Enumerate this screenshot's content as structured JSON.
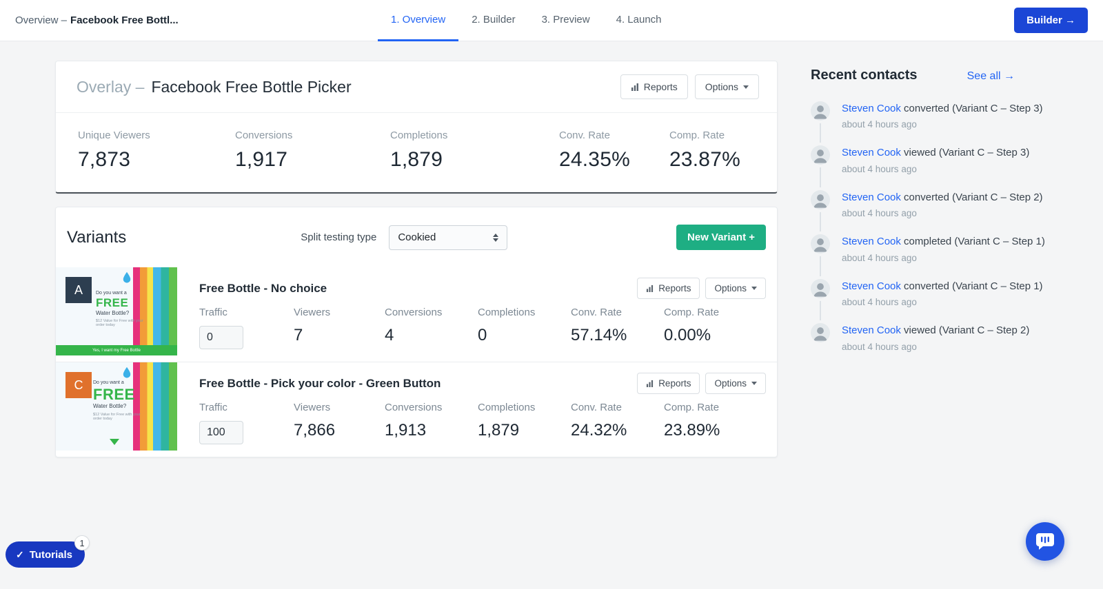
{
  "navbar": {
    "breadcrumb_prefix": "Overview –",
    "breadcrumb_title": "Facebook Free Bottl...",
    "tabs": [
      {
        "label": "1. Overview"
      },
      {
        "label": "2. Builder"
      },
      {
        "label": "3. Preview"
      },
      {
        "label": "4. Launch"
      }
    ],
    "builder_button": "Builder →"
  },
  "buttons": {
    "reports": "Reports",
    "options": "Options"
  },
  "overview": {
    "type_label": "Overlay –",
    "title": "Facebook Free Bottle Picker",
    "stats": [
      {
        "label": "Unique Viewers",
        "value": "7,873"
      },
      {
        "label": "Conversions",
        "value": "1,917"
      },
      {
        "label": "Completions",
        "value": "1,879"
      },
      {
        "label": "Conv. Rate",
        "value": "24.35%"
      },
      {
        "label": "Comp. Rate",
        "value": "23.87%"
      }
    ]
  },
  "variants": {
    "title": "Variants",
    "split_label": "Split testing type",
    "split_value": "Cookied",
    "new_variant": "New Variant +",
    "items": [
      {
        "letter": "A",
        "name": "Free Bottle - No choice",
        "traffic_label": "Traffic",
        "traffic_value": "0",
        "cols": [
          {
            "label": "Viewers",
            "value": "7"
          },
          {
            "label": "Conversions",
            "value": "4"
          },
          {
            "label": "Completions",
            "value": "0"
          },
          {
            "label": "Conv. Rate",
            "value": "57.14%"
          },
          {
            "label": "Comp. Rate",
            "value": "0.00%"
          }
        ]
      },
      {
        "letter": "C",
        "name": "Free Bottle - Pick your color - Green Button",
        "traffic_label": "Traffic",
        "traffic_value": "100",
        "cols": [
          {
            "label": "Viewers",
            "value": "7,866"
          },
          {
            "label": "Conversions",
            "value": "1,913"
          },
          {
            "label": "Completions",
            "value": "1,879"
          },
          {
            "label": "Conv. Rate",
            "value": "24.32%"
          },
          {
            "label": "Comp. Rate",
            "value": "23.89%"
          }
        ]
      }
    ]
  },
  "thumb": {
    "line1": "Do you want a",
    "free": "FREE",
    "line3": "Water Bottle?",
    "line4": "$12 Value for Free with your order today",
    "bar_text": "Yes, I want my Free Bottle"
  },
  "contacts": {
    "title": "Recent contacts",
    "see_all": "See all →",
    "items": [
      {
        "name": "Steven Cook",
        "action": " converted (Variant C – Step 3)",
        "time": "about 4 hours ago"
      },
      {
        "name": "Steven Cook",
        "action": " viewed (Variant C – Step 3)",
        "time": "about 4 hours ago"
      },
      {
        "name": "Steven Cook",
        "action": " converted (Variant C – Step 2)",
        "time": "about 4 hours ago"
      },
      {
        "name": "Steven Cook",
        "action": " completed (Variant C – Step 1)",
        "time": "about 4 hours ago"
      },
      {
        "name": "Steven Cook",
        "action": " converted (Variant C – Step 1)",
        "time": "about 4 hours ago"
      },
      {
        "name": "Steven Cook",
        "action": " viewed (Variant C – Step 2)",
        "time": "about 4 hours ago"
      }
    ]
  },
  "footer": {
    "tutorials": "Tutorials",
    "tutorials_badge": "1"
  },
  "icons": {
    "check": "✓"
  },
  "colors": {
    "accent_blue": "#2264f4",
    "deep_blue": "#1b46d6",
    "green": "#1eae83"
  }
}
